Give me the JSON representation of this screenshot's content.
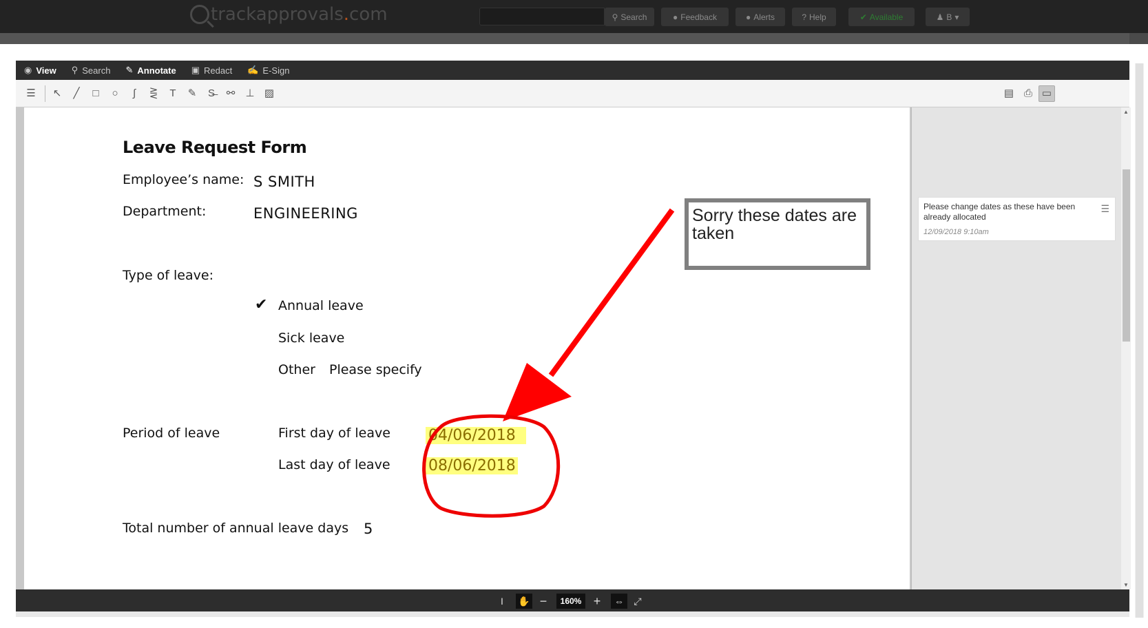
{
  "header": {
    "logo_main": "trackapprovals",
    "logo_dot": ".",
    "logo_tld": "com",
    "search_label": "Search",
    "feedback_label": "Feedback",
    "alerts_label": "Alerts",
    "help_label": "Help",
    "available_label": "Available",
    "user_label": "B"
  },
  "viewer": {
    "tabs": [
      {
        "label": "View",
        "icon": "eye-icon"
      },
      {
        "label": "Search",
        "icon": "search-icon"
      },
      {
        "label": "Annotate",
        "icon": "pencil-icon"
      },
      {
        "label": "Redact",
        "icon": "redact-icon"
      },
      {
        "label": "E-Sign",
        "icon": "esign-icon"
      }
    ],
    "active_tab": "Annotate",
    "zoom": "160%"
  },
  "document": {
    "title": "Leave Request Form",
    "employee_label": "Employee’s name:",
    "employee_value": "S SMITH",
    "department_label": "Department:",
    "department_value": "ENGINEERING",
    "type_label": "Type of leave:",
    "leave_annual": "Annual leave",
    "leave_sick": "Sick leave",
    "leave_other": "Other",
    "leave_other_hint": "Please specify",
    "check_mark": "✔",
    "period_label": "Period of leave",
    "first_day_label": "First day of leave",
    "first_day_value": "04/06/2018",
    "last_day_label": "Last day of leave",
    "last_day_value": "08/06/2018",
    "total_label": "Total number of annual leave days",
    "total_value": "5"
  },
  "annotations": {
    "note_text": "Sorry these dates are taken",
    "arrow_color": "#ff0000",
    "circle_color": "#ee0000",
    "note_border": "#808080",
    "highlight_color": "#ffff80"
  },
  "comments": [
    {
      "text": "Please change dates as these have been already allocated",
      "time": "12/09/2018 9:10am"
    }
  ]
}
